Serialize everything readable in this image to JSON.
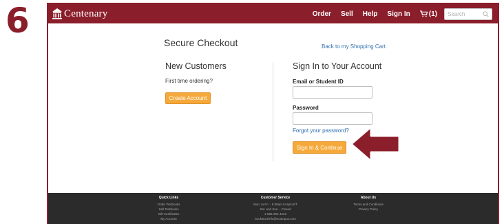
{
  "step": "6",
  "header": {
    "logo_text": "Centenary",
    "nav": [
      "Order",
      "Sell",
      "Help",
      "Sign In"
    ],
    "cart_label": "(1)",
    "search_placeholder": "Search"
  },
  "main": {
    "title": "Secure Checkout",
    "back_link": "Back to my Shopping Cart",
    "new_customers": {
      "heading": "New Customers",
      "subtext": "First time ordering?",
      "button": "Create Account"
    },
    "sign_in": {
      "heading": "Sign In to Your Account",
      "email_label": "Email or Student ID",
      "email_value": "",
      "password_label": "Password",
      "password_value": "",
      "forgot_link": "Forgot your password?",
      "button": "Sign In & Continue"
    }
  },
  "footer": {
    "quick_links": {
      "heading": "Quick Links",
      "items": [
        "Order Textbooks",
        "Sell Textbooks",
        "Gift Certificates",
        "My Account"
      ]
    },
    "customer_service": {
      "heading": "Customer Service",
      "items": [
        "Mon. to Fri. - 8:30am to 6pm ET",
        "Sat. and Sun. - Closed",
        "1-866-252-4222",
        "bookstoreinfo@ecampus.com"
      ]
    },
    "about_us": {
      "heading": "About Us",
      "items": [
        "Terms and Conditions",
        "Privacy Policy"
      ]
    }
  },
  "colors": {
    "brand": "#8b1e2b",
    "accent_button": "#f5a93a",
    "link": "#2f6fb0",
    "footer_bg": "#2b2b2b"
  },
  "icons": [
    "building-logo-icon",
    "cart-icon",
    "search-icon",
    "arrow-pointer-icon"
  ]
}
